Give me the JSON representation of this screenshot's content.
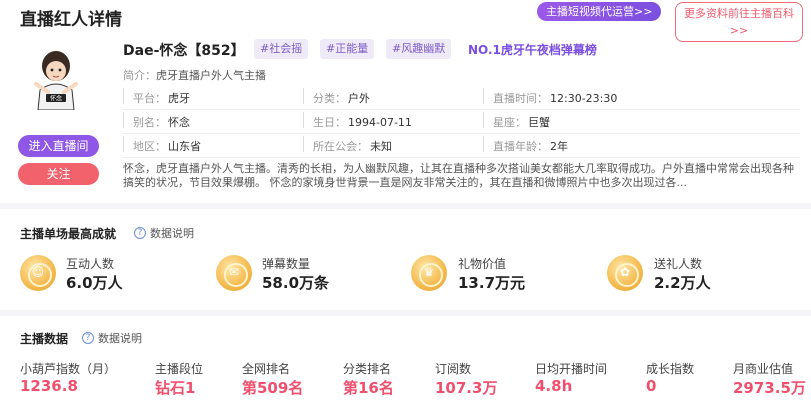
{
  "page_title": "直播红人详情",
  "agency_button": "主播短视频代运营>>",
  "more_button": "更多资料前往主播百科>>",
  "profile": {
    "name": "Dae-怀念【852】",
    "tags": [
      "#社会摇",
      "#正能量",
      "#风趣幽默"
    ],
    "rank_title": "NO.1虎牙午夜档弹幕榜",
    "intro_key": "简介：",
    "intro_value": "虎牙直播户外人气主播",
    "avatar_text": "怀念",
    "enter_live": "进入直播间",
    "follow": "关注",
    "fields": [
      [
        {
          "k": "平台：",
          "v": "虎牙"
        },
        {
          "k": "分类：",
          "v": "户外"
        },
        {
          "k": "直播时间：",
          "v": "12:30-23:30"
        }
      ],
      [
        {
          "k": "别名：",
          "v": "怀念"
        },
        {
          "k": "生日：",
          "v": "1994-07-11"
        },
        {
          "k": "星座：",
          "v": "巨蟹"
        }
      ],
      [
        {
          "k": "地区：",
          "v": "山东省"
        },
        {
          "k": "所在公会：",
          "v": "未知"
        },
        {
          "k": "直播年龄：",
          "v": "2年"
        }
      ]
    ],
    "description": "怀念，虎牙直播户外人气主播。清秀的长相，为人幽默风趣，让其在直播种多次搭讪美女都能大几率取得成功。户外直播中常常会出现各种搞笑的状况，节目效果爆棚。 怀念的家境身世背景一直是网友非常关注的，其在直播和微博照片中也多次出现过各..."
  },
  "best": {
    "title": "主播单场最高成就",
    "help": "数据说明",
    "items": [
      {
        "label": "互动人数",
        "value": "6.0万人"
      },
      {
        "label": "弹幕数量",
        "value": "58.0万条"
      },
      {
        "label": "礼物价值",
        "value": "13.7万元"
      },
      {
        "label": "送礼人数",
        "value": "2.2万人"
      }
    ]
  },
  "data": {
    "title": "主播数据",
    "help": "数据说明",
    "items": [
      {
        "label": "小葫芦指数（月）",
        "value": "1236.8"
      },
      {
        "label": "主播段位",
        "value": "钻石1"
      },
      {
        "label": "全网排名",
        "value": "第509名"
      },
      {
        "label": "分类排名",
        "value": "第16名"
      },
      {
        "label": "订阅数",
        "value": "107.3万"
      },
      {
        "label": "日均开播时间",
        "value": "4.8h"
      },
      {
        "label": "成长指数",
        "value": "0"
      },
      {
        "label": "月商业估值",
        "value": "2973.5万"
      }
    ]
  }
}
